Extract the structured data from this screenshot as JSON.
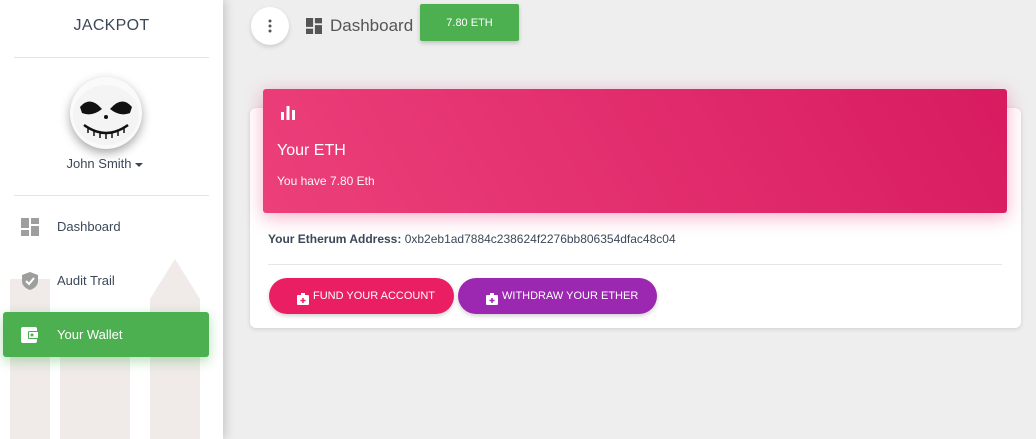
{
  "sidebar": {
    "brand": "JACKPOT",
    "user_name": "John Smith",
    "items": [
      {
        "label": "Dashboard",
        "icon": "dashboard-icon"
      },
      {
        "label": "Audit Trail",
        "icon": "shield-icon"
      },
      {
        "label": "Your Wallet",
        "icon": "wallet-icon",
        "active": true
      }
    ]
  },
  "header": {
    "title": "Dashboard",
    "balance_button": "7.80 ETH"
  },
  "card": {
    "title": "Your ETH",
    "subtitle": "You have 7.80 Eth",
    "address_label": "Your Etherum Address:",
    "address_value": "0xb2eb1ad7884c238624f2276bb806354dfac48c04",
    "fund_button": "FUND YOUR ACCOUNT",
    "withdraw_button": "WITHDRAW YOUR ETHER"
  },
  "colors": {
    "accent_green": "#4caf50",
    "header_pink": "#e91e63",
    "withdraw_purple": "#9c27b0"
  }
}
